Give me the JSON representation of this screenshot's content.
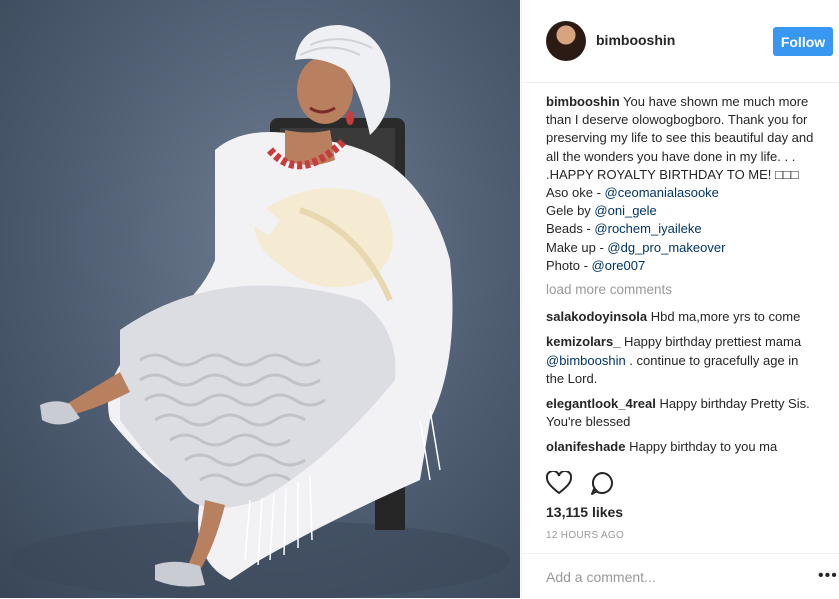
{
  "header": {
    "username": "bimbooshin",
    "follow_label": "Follow"
  },
  "caption": {
    "username": "bimbooshin",
    "text1": " You have shown me much more than I deserve olowogbogboro. Thank you for preserving my life to see this beautiful day and all the wonders you have done in my life. . . .HAPPY ROYALTY BIRTHDAY TO ME! □□□ Aso oke - ",
    "mention1": "@ceomanialasooke",
    "text2": "Gele by ",
    "mention2": "@oni_gele",
    "text3": "Beads - ",
    "mention3": "@rochem_iyaileke",
    "text4": "Make up - ",
    "mention4": "@dg_pro_makeover",
    "text5": "Photo - ",
    "mention5": "@ore007"
  },
  "load_more_label": "load more comments",
  "comments": [
    {
      "user": "salakodoyinsola",
      "text": " Hbd ma,more yrs to come"
    },
    {
      "user": "kemizolars_",
      "text_a": "  Happy birthday prettiest mama ",
      "mention": "@bimbooshin",
      "text_b": " . continue to gracefully age in the Lord."
    },
    {
      "user": "elegantlook_4real",
      "text": " Happy birthday Pretty Sis. You're blessed"
    },
    {
      "user": "olanifeshade",
      "text": " Happy birthday to you ma"
    }
  ],
  "likes": "13,115 likes",
  "timestamp": "12 HOURS AGO",
  "add_comment_placeholder": "Add a comment...",
  "icons": {
    "like": "heart-icon",
    "comment": "comment-icon",
    "more": "more-options-icon"
  },
  "colors": {
    "follow": "#3897f0",
    "mention": "#003569",
    "muted": "#999999"
  }
}
